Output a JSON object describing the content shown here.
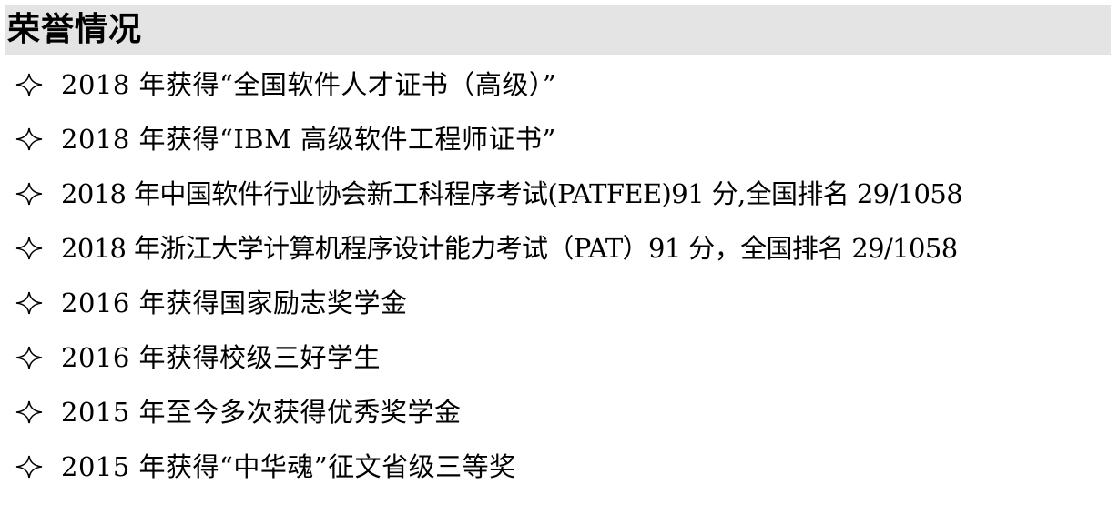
{
  "section": {
    "title": "荣誉情况",
    "header_bg": "#e4e4e4"
  },
  "bullet_icon": "diamond-outline-icon",
  "honors": [
    {
      "text": "2018 年获得“全国软件人才证书（高级）”"
    },
    {
      "text": "2018 年获得“IBM 高级软件工程师证书”"
    },
    {
      "text": "2018 年中国软件行业协会新工科程序考试(PATFEE)91 分,全国排名 29/1058"
    },
    {
      "text": "2018 年浙江大学计算机程序设计能力考试（PAT）91 分，全国排名 29/1058"
    },
    {
      "text": "2016 年获得国家励志奖学金"
    },
    {
      "text": "2016 年获得校级三好学生"
    },
    {
      "text": "2015 年至今多次获得优秀奖学金"
    },
    {
      "text": "2015 年获得“中华魂”征文省级三等奖"
    }
  ]
}
